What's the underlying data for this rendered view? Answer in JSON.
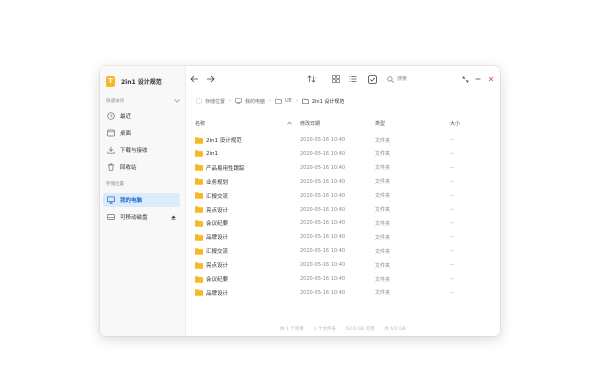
{
  "app": {
    "logo_letter": "T",
    "title": "2in1 设计规范"
  },
  "sidebar": {
    "quick_label": "快速访问",
    "quick_items": [
      {
        "label": "最近",
        "icon": "clock-icon"
      },
      {
        "label": "桌面",
        "icon": "desktop-icon"
      },
      {
        "label": "下载与接收",
        "icon": "download-icon"
      },
      {
        "label": "回收站",
        "icon": "trash-icon"
      }
    ],
    "storage_label": "存储位置",
    "storage_items": [
      {
        "label": "我的电脑",
        "icon": "computer-icon",
        "active": true
      },
      {
        "label": "可移动磁盘",
        "icon": "drive-icon"
      }
    ]
  },
  "search": {
    "placeholder": "搜索"
  },
  "breadcrumb": [
    {
      "label": "存储位置",
      "icon": "storage-icon"
    },
    {
      "label": "我的电脑",
      "icon": "computer-icon"
    },
    {
      "label": "UE",
      "icon": "folder-outline-icon"
    },
    {
      "label": "2in1 设计规范",
      "icon": "folder-outline-icon"
    }
  ],
  "columns": {
    "name": "名称",
    "modified": "修改日期",
    "type": "类型",
    "size": "大小"
  },
  "files": [
    {
      "name": "2in1 设计规范",
      "modified": "2020-05-16 10:40",
      "type": "文件夹",
      "size": "--"
    },
    {
      "name": "2in1",
      "modified": "2020-05-16 10:40",
      "type": "文件夹",
      "size": "--"
    },
    {
      "name": "产品易用性跟踪",
      "modified": "2020-05-16 10:40",
      "type": "文件夹",
      "size": "--"
    },
    {
      "name": "业务规划",
      "modified": "2020-05-16 10:40",
      "type": "文件夹",
      "size": "--"
    },
    {
      "name": "汇报交流",
      "modified": "2020-05-16 10:40",
      "type": "文件夹",
      "size": "--"
    },
    {
      "name": "亮点设计",
      "modified": "2020-05-16 10:40",
      "type": "文件夹",
      "size": "--"
    },
    {
      "name": "会议纪要",
      "modified": "2020-05-16 10:40",
      "type": "文件夹",
      "size": "--"
    },
    {
      "name": "品牌设计",
      "modified": "2020-05-16 10:40",
      "type": "文件夹",
      "size": "--"
    },
    {
      "name": "汇报交流",
      "modified": "2020-05-16 10:40",
      "type": "文件夹",
      "size": "--"
    },
    {
      "name": "亮点设计",
      "modified": "2020-05-16 10:40",
      "type": "文件夹",
      "size": "--"
    },
    {
      "name": "会议纪要",
      "modified": "2020-05-16 10:40",
      "type": "文件夹",
      "size": "--"
    },
    {
      "name": "品牌设计",
      "modified": "2020-05-16 10:40",
      "type": "文件夹",
      "size": "--"
    }
  ],
  "status": {
    "items": "共 1 个项目",
    "selected": "1 个文件夹",
    "space": "63.6 GB 可用",
    "count": "共 1/2 GB"
  },
  "colors": {
    "accent": "#1f6fd6",
    "active_bg": "#dcebfa",
    "folder": "#f8b726",
    "logo": "#f8b726"
  }
}
